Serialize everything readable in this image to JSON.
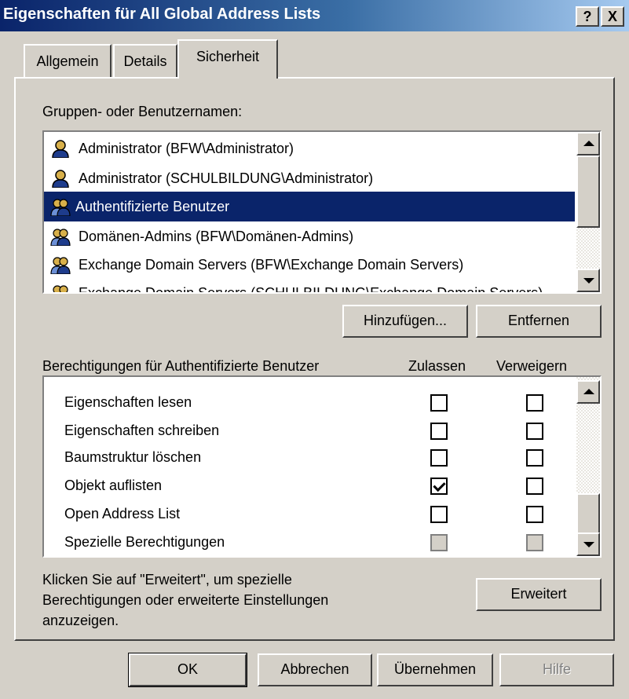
{
  "window": {
    "title": "Eigenschaften für All Global Address Lists",
    "help_button": "?",
    "close_button": "X"
  },
  "tabs": [
    {
      "label": "Allgemein",
      "active": false
    },
    {
      "label": "Details",
      "active": false
    },
    {
      "label": "Sicherheit",
      "active": true
    }
  ],
  "users_section": {
    "label": "Gruppen- oder Benutzernamen:",
    "items": [
      {
        "label": "Administrator (BFW\\Administrator)",
        "icon": "user-icon"
      },
      {
        "label": "Administrator (SCHULBILDUNG\\Administrator)",
        "icon": "user-icon"
      },
      {
        "label": "Authentifizierte Benutzer",
        "icon": "group-icon",
        "selected": true
      },
      {
        "label": "Domänen-Admins (BFW\\Domänen-Admins)",
        "icon": "group-icon"
      },
      {
        "label": "Exchange Domain Servers (BFW\\Exchange Domain Servers)",
        "icon": "group-icon"
      },
      {
        "label": "Exchange Domain Servers (SCHULBILDUNG\\Exchange Domain Servers)",
        "icon": "group-icon"
      }
    ],
    "add_button": "Hinzufügen...",
    "remove_button": "Entfernen"
  },
  "permissions": {
    "label": "Berechtigungen für Authentifizierte Benutzer",
    "allow_header": "Zulassen",
    "deny_header": "Verweigern",
    "rows": [
      {
        "name": "Eigenschaften lesen",
        "allow": false,
        "deny": false
      },
      {
        "name": "Eigenschaften schreiben",
        "allow": false,
        "deny": false
      },
      {
        "name": "Baumstruktur löschen",
        "allow": false,
        "deny": false
      },
      {
        "name": "Objekt auflisten",
        "allow": true,
        "deny": false
      },
      {
        "name": "Open Address List",
        "allow": false,
        "deny": false
      },
      {
        "name": "Spezielle Berechtigungen",
        "allow": false,
        "deny": false,
        "disabled": true
      }
    ]
  },
  "advanced": {
    "text_line1": "Klicken Sie auf \"Erweitert\", um spezielle",
    "text_line2": "Berechtigungen oder erweiterte Einstellungen",
    "text_line3": "anzuzeigen.",
    "button": "Erweitert"
  },
  "footer": {
    "ok": "OK",
    "cancel": "Abbrechen",
    "apply": "Übernehmen",
    "help": "Hilfe"
  },
  "colors": {
    "titlebar_start": "#0a246a",
    "titlebar_end": "#a6caf0",
    "selection": "#0a246a",
    "face": "#d4d0c8"
  }
}
